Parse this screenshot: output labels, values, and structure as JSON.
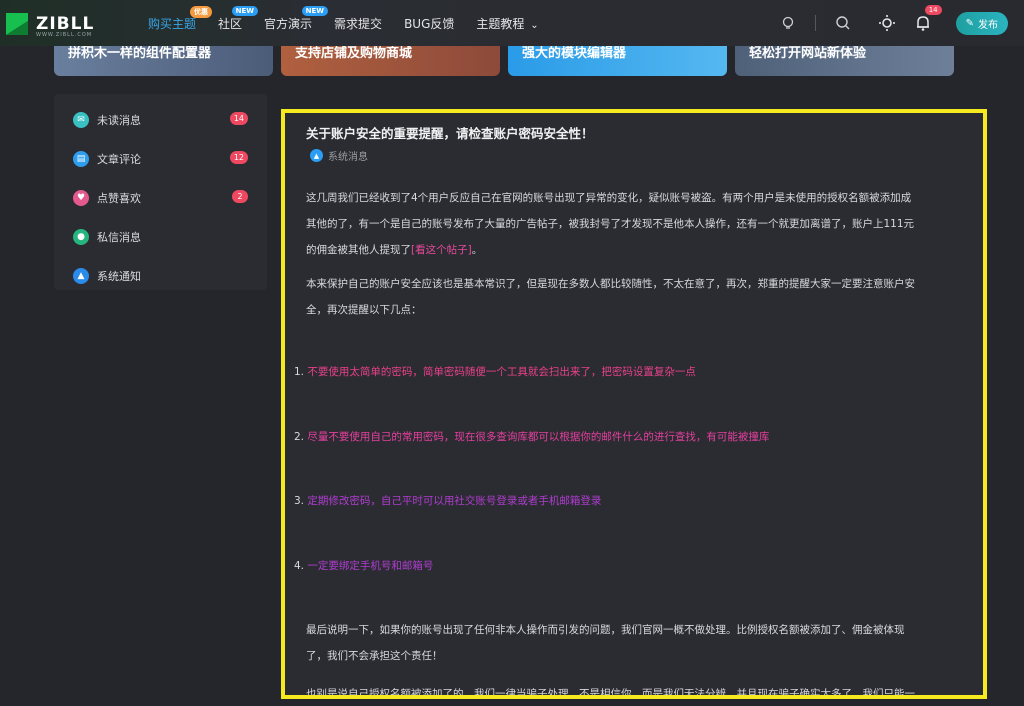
{
  "brand": {
    "logo_text": "ZIBLL",
    "logo_sub": "WWW.ZIBLL.COM"
  },
  "nav": {
    "items": [
      {
        "label": "购买主题",
        "badge": "优惠",
        "badge_color": "#f59b3e",
        "active": true
      },
      {
        "label": "社区",
        "badge": "NEW",
        "badge_color": "#2a9df4"
      },
      {
        "label": "官方演示",
        "badge": "NEW",
        "badge_color": "#2a9df4"
      },
      {
        "label": "需求提交"
      },
      {
        "label": "BUG反馈"
      },
      {
        "label": "主题教程",
        "dropdown": true
      }
    ],
    "bell_count": "14",
    "publish_label": "发布"
  },
  "banners": [
    {
      "text": "拼积木一样的组件配置器",
      "color": "#5b6f8e"
    },
    {
      "text": "支持店铺及购物商城",
      "color": "#a45a3c"
    },
    {
      "text": "强大的模块编辑器",
      "color": "#2a8fe0"
    },
    {
      "text": "轻松打开网站新体验",
      "color": "#4a5a74"
    }
  ],
  "sidebar": {
    "items": [
      {
        "label": "未读消息",
        "badge": "14",
        "icon_color": "#3ac0c2",
        "icon": "envelope-icon"
      },
      {
        "label": "文章评论",
        "badge": "12",
        "icon_color": "#2f9dee",
        "icon": "comment-icon"
      },
      {
        "label": "点赞喜欢",
        "badge": "2",
        "icon_color": "#e45a8f",
        "icon": "heart-icon"
      },
      {
        "label": "私信消息",
        "badge": "",
        "icon_color": "#26b57e",
        "icon": "chat-icon"
      },
      {
        "label": "系统通知",
        "badge": "",
        "icon_color": "#2a8bea",
        "icon": "bell-icon"
      }
    ]
  },
  "article": {
    "title": "关于账户安全的重要提醒，请检查账户密码安全性！",
    "meta": "系统消息",
    "p1_a": "这几周我们已经收到了4个用户反应自己在官网的账号出现了异常的变化，疑似账号被盗。有两个用户是未使用的授权名额被添加成",
    "p1_b": "其他的了，有一个是自己的账号发布了大量的广告帖子，被我封号了才发现不是他本人操作，还有一个就更加离谱了，账户上111元",
    "p1_c": "的佣金被其他人提现了",
    "p1_link": "[看这个帖子]",
    "p1_end": "。",
    "p2_a": "本来保护自己的账户安全应该也是基本常识了，但是现在多数人都比较随性，不太在意了，再次，郑重的提醒大家一定要注意账户安",
    "p2_b": "全，再次提醒以下几点：",
    "list": [
      {
        "num": "1.",
        "text": "不要使用太简单的密码，简单密码随便一个工具就会扫出来了，把密码设置复杂一点"
      },
      {
        "num": "2.",
        "text": "尽量不要使用自己的常用密码，现在很多查询库都可以根据你的邮件什么的进行查找，有可能被撞库"
      },
      {
        "num": "3.",
        "text": "定期修改密码，自己平时可以用社交账号登录或者手机邮箱登录"
      },
      {
        "num": "4.",
        "text": "一定要绑定手机号和邮箱号"
      }
    ],
    "p3_a": "最后说明一下，如果你的账号出现了任何非本人操作而引发的问题，我们官网一概不做处理。比例授权名额被添加了、佣金被体现",
    "p3_b": "了，我们不会承担这个责任！",
    "p4": "也别是说自己授权名额被添加了的，我们一律当骗子处理，不是相信你，而是我们无法分辨，并且现在骗子确实太多了，我们只能一"
  }
}
